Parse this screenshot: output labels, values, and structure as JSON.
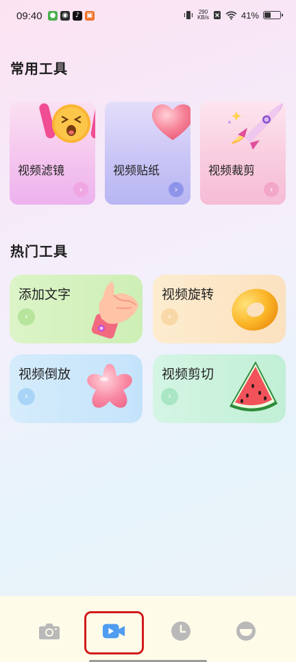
{
  "status_bar": {
    "time": "09:40",
    "network_speed_value": "290",
    "network_speed_unit": "KB/s",
    "battery_percent": "41%",
    "battery_level": 0.41
  },
  "sections": {
    "common_title": "常用工具",
    "hot_title": "热门工具"
  },
  "common_tools": [
    {
      "label": "视频滤镜",
      "icon": "shocked-emoji-icon"
    },
    {
      "label": "视频贴纸",
      "icon": "heart-icon"
    },
    {
      "label": "视频裁剪",
      "icon": "rocket-icon"
    }
  ],
  "hot_tools": [
    {
      "label": "添加文字",
      "icon": "hand-icon"
    },
    {
      "label": "视频旋转",
      "icon": "donut-icon"
    },
    {
      "label": "视频倒放",
      "icon": "star-jelly-icon"
    },
    {
      "label": "视频剪切",
      "icon": "watermelon-icon"
    }
  ],
  "bottom_nav": [
    {
      "name": "camera",
      "icon": "camera-icon",
      "selected": false
    },
    {
      "name": "video",
      "icon": "video-icon",
      "selected": true
    },
    {
      "name": "history",
      "icon": "clock-icon",
      "selected": false
    },
    {
      "name": "profile",
      "icon": "face-icon",
      "selected": false
    }
  ],
  "colors": {
    "selected_nav": "#4f9cf0",
    "unselected_nav": "#b9b9b9",
    "highlight_border": "#d11b1b"
  }
}
